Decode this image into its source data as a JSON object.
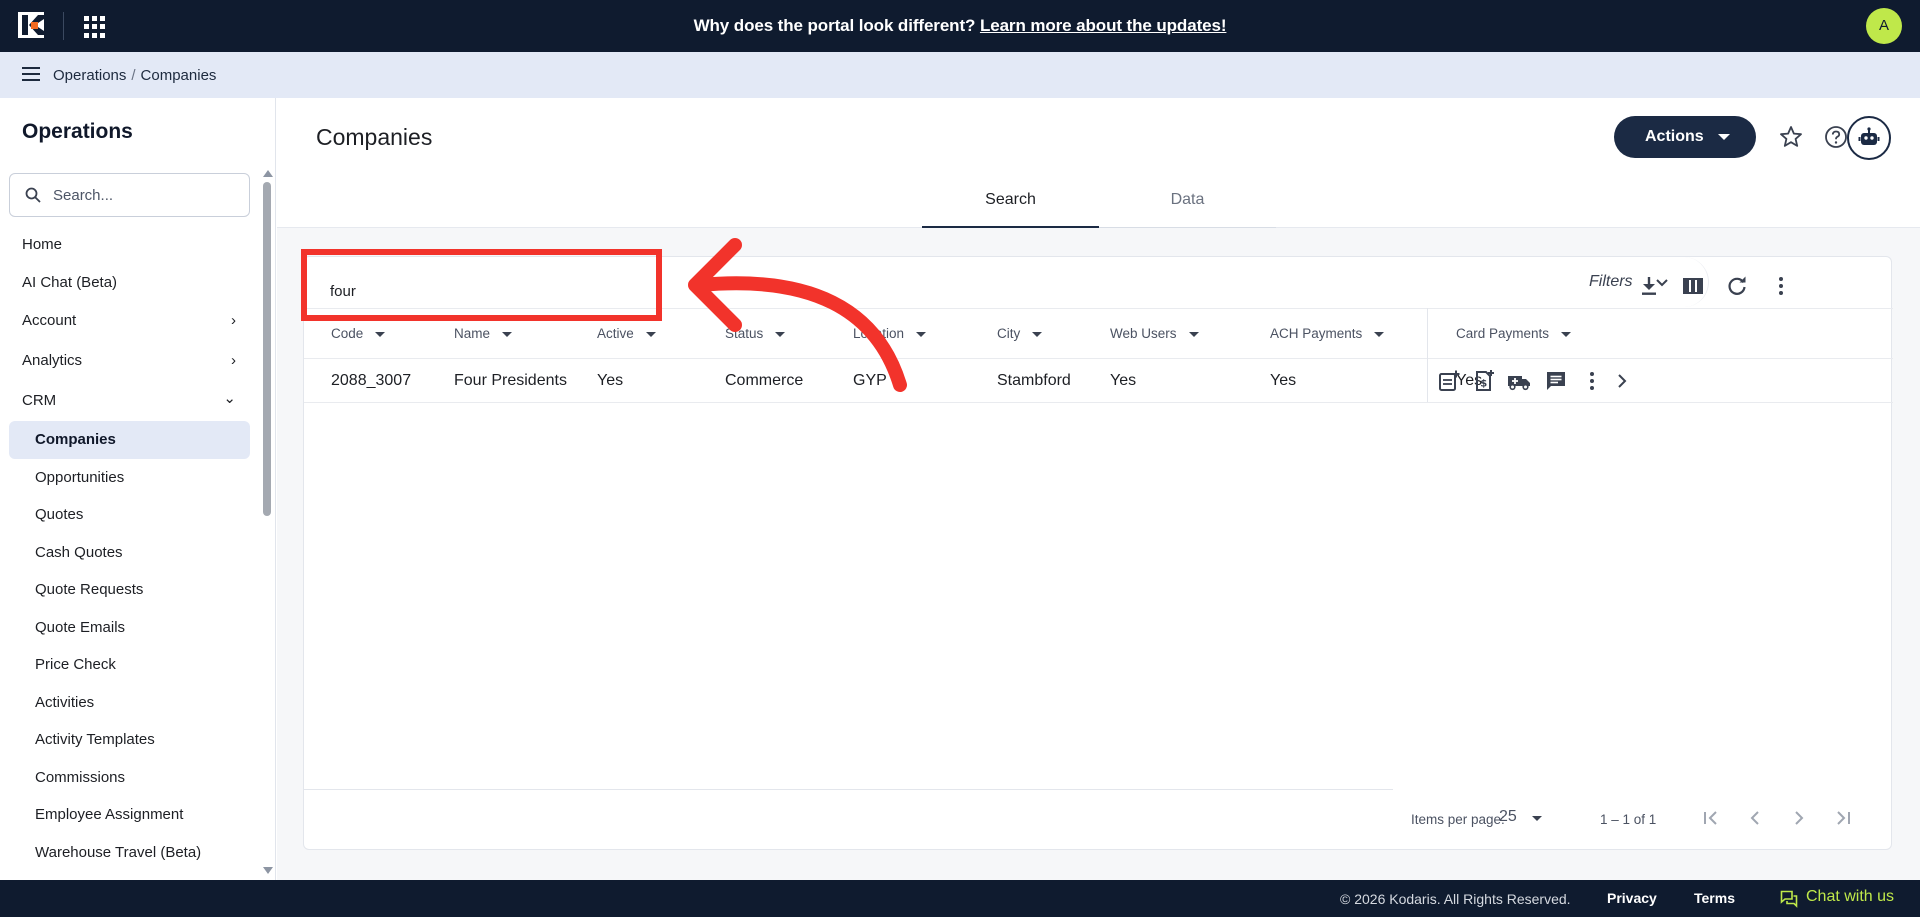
{
  "topbar": {
    "banner_text": "Why does the portal look different?",
    "banner_link": "Learn more about the updates!",
    "avatar_initial": "A"
  },
  "breadcrumb": {
    "items": [
      "Operations",
      "Companies"
    ],
    "separator": "/"
  },
  "sidebar": {
    "title": "Operations",
    "search_placeholder": "Search...",
    "items": [
      {
        "label": "Home"
      },
      {
        "label": "AI Chat (Beta)"
      },
      {
        "label": "Account",
        "expanded": false
      },
      {
        "label": "Analytics",
        "expanded": false
      },
      {
        "label": "CRM",
        "expanded": true
      },
      {
        "label": "Companies",
        "active": true
      },
      {
        "label": "Opportunities"
      },
      {
        "label": "Quotes"
      },
      {
        "label": "Cash Quotes"
      },
      {
        "label": "Quote Requests"
      },
      {
        "label": "Quote Emails"
      },
      {
        "label": "Price Check"
      },
      {
        "label": "Activities"
      },
      {
        "label": "Activity Templates"
      },
      {
        "label": "Commissions"
      },
      {
        "label": "Employee Assignment"
      },
      {
        "label": "Warehouse Travel (Beta)"
      }
    ]
  },
  "main": {
    "title": "Companies",
    "actions_label": "Actions",
    "tabs": [
      {
        "label": "Search",
        "active": true
      },
      {
        "label": "Data",
        "active": false
      }
    ],
    "search_value": "four",
    "filters_label": "Filters",
    "columns": [
      "Code",
      "Name",
      "Active",
      "Status",
      "Location",
      "City",
      "Web Users",
      "ACH Payments",
      "Card Payments"
    ],
    "rows": [
      {
        "Code": "2088_3007",
        "Name": "Four Presidents",
        "Active": "Yes",
        "Status": "Commerce",
        "Location": "GYP",
        "City": "Stambford",
        "Web Users": "Yes",
        "ACH Payments": "Yes",
        "Card Payments": "Yes"
      }
    ],
    "paginator": {
      "items_per_page_label": "Items per page:",
      "items_per_page": "25",
      "range": "1 – 1 of 1"
    }
  },
  "footer": {
    "copyright": "© 2026 Kodaris. All Rights Reserved.",
    "privacy": "Privacy",
    "terms": "Terms",
    "chat": "Chat with us"
  },
  "colors": {
    "topbar": "#0f1b2f",
    "accent": "#bfe84a",
    "primary_button": "#1b2a44",
    "annotation": "#f2332b"
  }
}
